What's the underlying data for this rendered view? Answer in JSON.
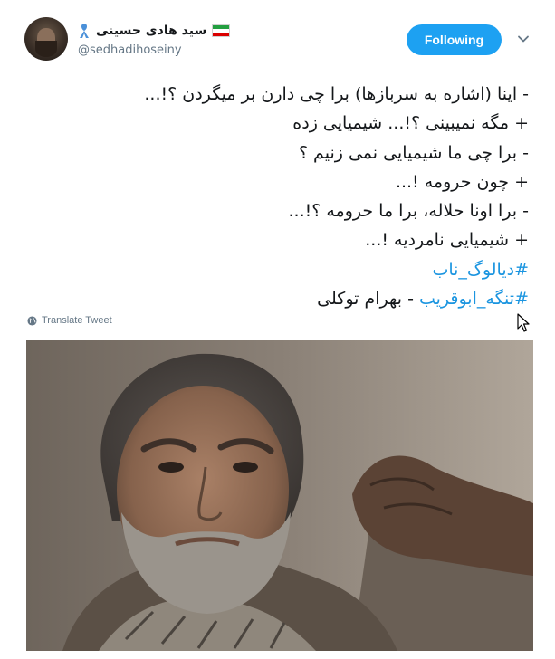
{
  "user": {
    "display_name": "سید هادی حسینی",
    "handle": "@sedhadihoseiny"
  },
  "follow_button": {
    "label": "Following"
  },
  "tweet": {
    "lines": [
      "- اینا (اشاره به سربازها) برا چی دارن بر میگردن ؟!...",
      "+ مگه نمیبینی ؟!... شیمیایی زده",
      "- برا چی ما شیمیایی نمی زنیم ؟",
      "+ چون حرومه !...",
      "- برا اونا حلاله، برا ما حرومه ؟!...",
      "+ شیمیایی نامردیه !..."
    ],
    "hashtag_1": "#دیالوگ_ناب",
    "hashtag_2": "#تنگه_ابوقریب",
    "credit": "- بهرام توکلی"
  },
  "translate": {
    "label": "Translate Tweet"
  },
  "icons": {
    "follow_menu": "chevron-down-icon",
    "translate": "globe-icon",
    "awareness": "ribbon-icon",
    "flag": "iran-flag-icon",
    "pointer": "mouse-cursor-icon"
  },
  "colors": {
    "accent": "#1da1f2",
    "hashtag": "#1b95e0",
    "text": "#14171a",
    "muted": "#657786"
  }
}
